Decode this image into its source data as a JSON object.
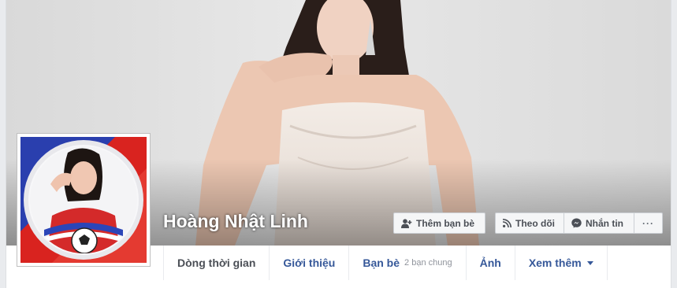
{
  "profile": {
    "name": "Hoàng Nhật Linh"
  },
  "actions": {
    "add_friend": "Thêm bạn bè",
    "follow": "Theo dõi",
    "message": "Nhắn tin",
    "more": "···"
  },
  "tabs": [
    {
      "label": "Dòng thời gian"
    },
    {
      "label": "Giới thiệu"
    },
    {
      "label": "Bạn bè",
      "sub": "2 bạn chung"
    },
    {
      "label": "Ảnh"
    },
    {
      "label": "Xem thêm"
    }
  ],
  "colors": {
    "link": "#365899",
    "button_bg": "#f5f6f7",
    "page_bg": "#e9ebee"
  }
}
